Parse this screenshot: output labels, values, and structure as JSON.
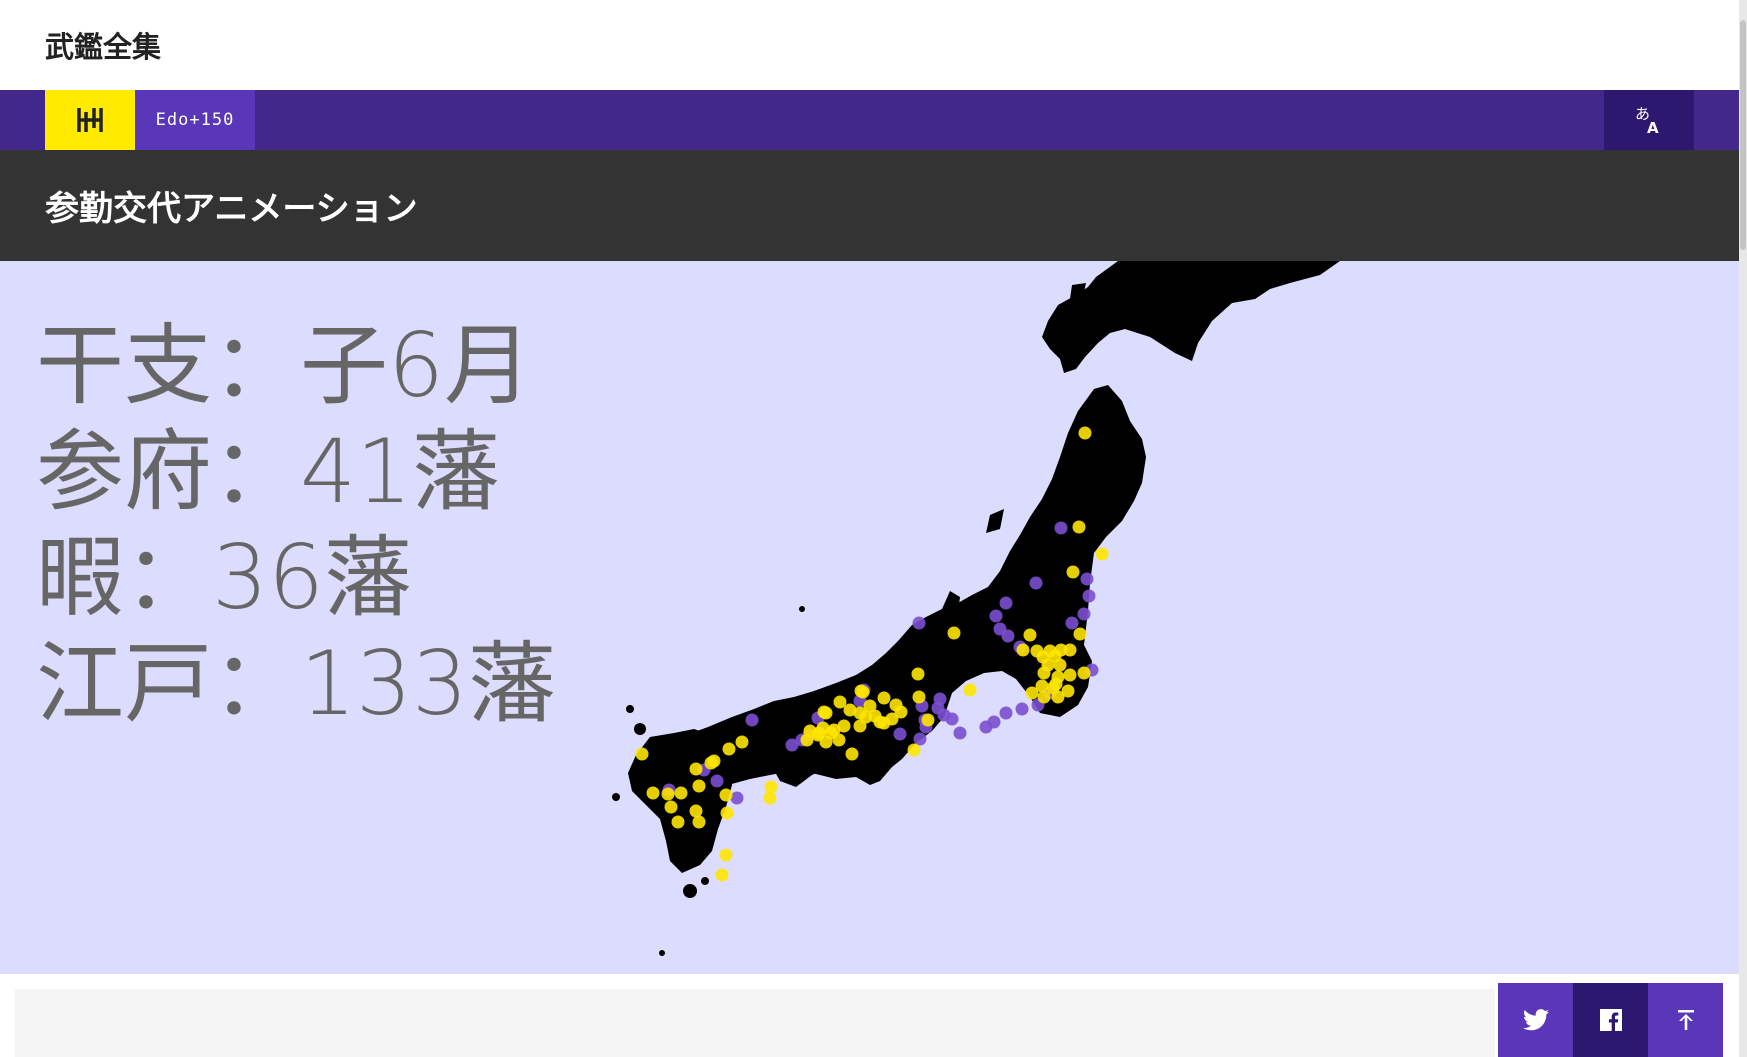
{
  "site": {
    "title": "武鑑全集"
  },
  "nav": {
    "edo_label": "Edo+150",
    "lang_icon": "language-icon",
    "logo_icon": "h-logo-icon"
  },
  "page": {
    "title": "参勤交代アニメーション"
  },
  "stats": {
    "eto": "干支：子6月",
    "sanpu": "参府：41藩",
    "itoma": "暇：36藩",
    "edo": "江戸：133藩"
  },
  "colors": {
    "accent": "#42288a",
    "logo_yellow": "#ffea00",
    "map_bg": "#dcdcff",
    "land": "#000000",
    "dot_yellow": "#ffe600",
    "dot_purple": "#7a4fd0"
  },
  "share": {
    "icons": [
      "twitter-icon",
      "facebook-icon",
      "scroll-top-icon"
    ]
  }
}
